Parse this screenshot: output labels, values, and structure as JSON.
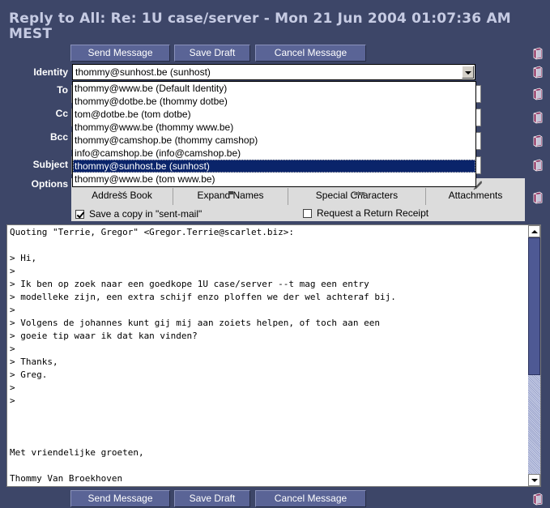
{
  "window": {
    "title_line1": "Reply to All: Re: 1U case/server - Mon 21 Jun 2004 01:07:36 AM",
    "title_line2": "MEST"
  },
  "toolbar": {
    "send_label": "Send Message",
    "save_label": "Save Draft",
    "cancel_label": "Cancel Message"
  },
  "form": {
    "identity_label": "Identity",
    "to_label": "To",
    "cc_label": "Cc",
    "bcc_label": "Bcc",
    "subject_label": "Subject",
    "options_label": "Options",
    "identity_value": "thommy@sunhost.be (sunhost)"
  },
  "identity_options": [
    "thommy@www.be (Default Identity)",
    "thommy@dotbe.be (thommy dotbe)",
    "tom@dotbe.be (tom dotbe)",
    "thommy@www.be (thommy www.be)",
    "thommy@camshop.be (thommy camshop)",
    "info@camshop.be (info@camshop.be)",
    "thommy@sunhost.be (sunhost)",
    "thommy@www.be (tom www.be)"
  ],
  "options": {
    "address_book": "Address Book",
    "expand_names": "Expand Names",
    "special_characters": "Special Characters",
    "attachments": "Attachments",
    "save_copy": "Save a copy in \"sent-mail\"",
    "return_receipt": "Request a Return Receipt",
    "save_copy_checked": true,
    "return_receipt_checked": false
  },
  "body": {
    "text": "Quoting \"Terrie, Gregor\" <Gregor.Terrie@scarlet.biz>:\n\n> Hi,\n>\n> Ik ben op zoek naar een goedkope 1U case/server --t mag een entry\n> modelleke zijn, een extra schijf enzo ploffen we der wel achteraf bij.\n>\n> Volgens de johannes kunt gij mij aan zoiets helpen, of toch aan een\n> goeie tip waar ik dat kan vinden?\n>\n> Thanks,\n> Greg.\n>\n>\n\n\n\nMet vriendelijke groeten,\n\nThommy Van Broekhoven"
  },
  "colors": {
    "background": "#3d4668",
    "button": "#5a6496",
    "selected": "#0a246a",
    "scroll_thumb": "#4e5994"
  },
  "icons": [
    "help-book-icon",
    "address-book-icon",
    "expand-names-icon",
    "special-characters-icon",
    "attachment-icon"
  ]
}
